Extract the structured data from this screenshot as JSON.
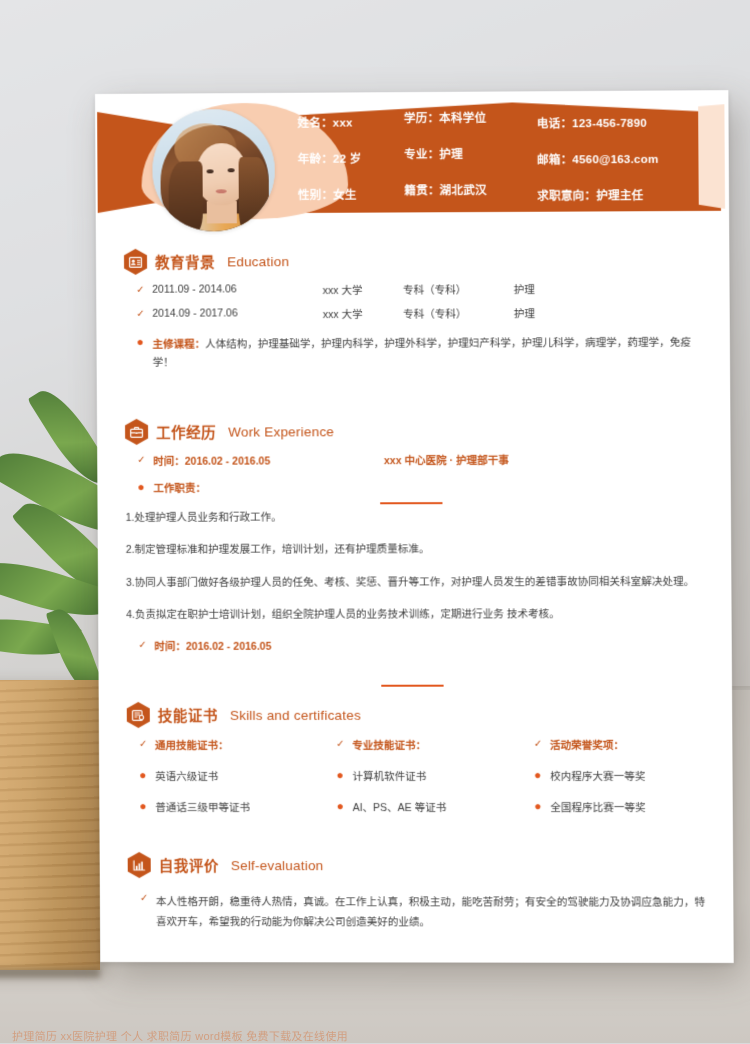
{
  "header": {
    "photo_alt": "profile-photo",
    "fields": [
      {
        "label": "姓名：",
        "value": "xxx",
        "name": "field-name"
      },
      {
        "label": "学历：",
        "value": "本科学位",
        "name": "field-education-level"
      },
      {
        "label": "电话：",
        "value": "123-456-7890",
        "name": "field-phone"
      },
      {
        "label": "年龄：",
        "value": "22 岁",
        "name": "field-age"
      },
      {
        "label": "专业：",
        "value": "护理",
        "name": "field-major"
      },
      {
        "label": "邮箱：",
        "value": "4560@163.com",
        "name": "field-email"
      },
      {
        "label": "性别：",
        "value": "女生",
        "name": "field-gender"
      },
      {
        "label": "籍贯：",
        "value": "湖北武汉",
        "name": "field-hometown"
      },
      {
        "label": "求职意向：",
        "value": "护理主任",
        "name": "field-job-objective"
      }
    ],
    "field_text": [
      "姓名：xxx",
      "学历：本科学位",
      "电话：123-456-7890",
      "年龄：22 岁",
      "专业：护理",
      "邮箱：4560@163.com",
      "性别：女生",
      "籍贯：湖北武汉",
      "求职意向：护理主任"
    ]
  },
  "education": {
    "title_cn": "教育背景",
    "title_en": "Education",
    "icon": "id-card-icon",
    "entries": [
      {
        "date": "2011.09 - 2014.06",
        "school": "xxx 大学",
        "degree": "专科（专科）",
        "major": "护理"
      },
      {
        "date": "2014.09 - 2017.06",
        "school": "xxx 大学",
        "degree": "专科（专科）",
        "major": "护理"
      }
    ],
    "courses_label": "主修课程：",
    "courses_text": "人体结构，护理基础学，护理内科学，护理外科学，护理妇产科学，护理儿科学，病理学，药理学，免疫学！"
  },
  "work": {
    "title_cn": "工作经历",
    "title_en": "Work Experience",
    "icon": "briefcase-icon",
    "time_label": "时间：2016.02 - 2016.05",
    "org_label": "xxx 中心医院 · 护理部干事",
    "duty_label": "工作职责：",
    "duties": [
      "1.处理护理人员业务和行政工作。",
      "2.制定管理标准和护理发展工作，培训计划，还有护理质量标准。",
      "3.协同人事部门做好各级护理人员的任免、考核、奖惩、晋升等工作，对护理人员发生的差错事故协同相关科室解决处理。",
      "4.负责拟定在职护士培训计划，组织全院护理人员的业务技术训练，定期进行业务 技术考核。"
    ],
    "time_label_2": "时间：2016.02 - 2016.05"
  },
  "skills": {
    "title_cn": "技能证书",
    "title_en": "Skills and certificates",
    "icon": "certificate-icon",
    "columns": [
      {
        "heading": "通用技能证书：",
        "items": [
          "英语六级证书",
          "普通话三级甲等证书"
        ]
      },
      {
        "heading": "专业技能证书：",
        "items": [
          "计算机软件证书",
          "AI、PS、AE 等证书"
        ]
      },
      {
        "heading": "活动荣誉奖项：",
        "items": [
          "校内程序大赛一等奖",
          "全国程序比赛一等奖"
        ]
      }
    ]
  },
  "self": {
    "title_cn": "自我评价",
    "title_en": "Self-evaluation",
    "icon": "bar-chart-icon",
    "text": "本人性格开朗，稳重待人热情，真诚。在工作上认真，积极主动，能吃苦耐劳；有安全的驾驶能力及协调应急能力，特喜欢开车，希望我的行动能为你解决公司创造美好的业绩。"
  },
  "watermark": "护理简历 xx医院护理 个人 求职简历 word模板 免费下载及在线使用",
  "colors": {
    "accent": "#c4551b",
    "accent_bright": "#e2571e",
    "photo_arc": "#f8cdb0",
    "page_bg": "#ffffff",
    "body_text": "#3d3d3d"
  }
}
